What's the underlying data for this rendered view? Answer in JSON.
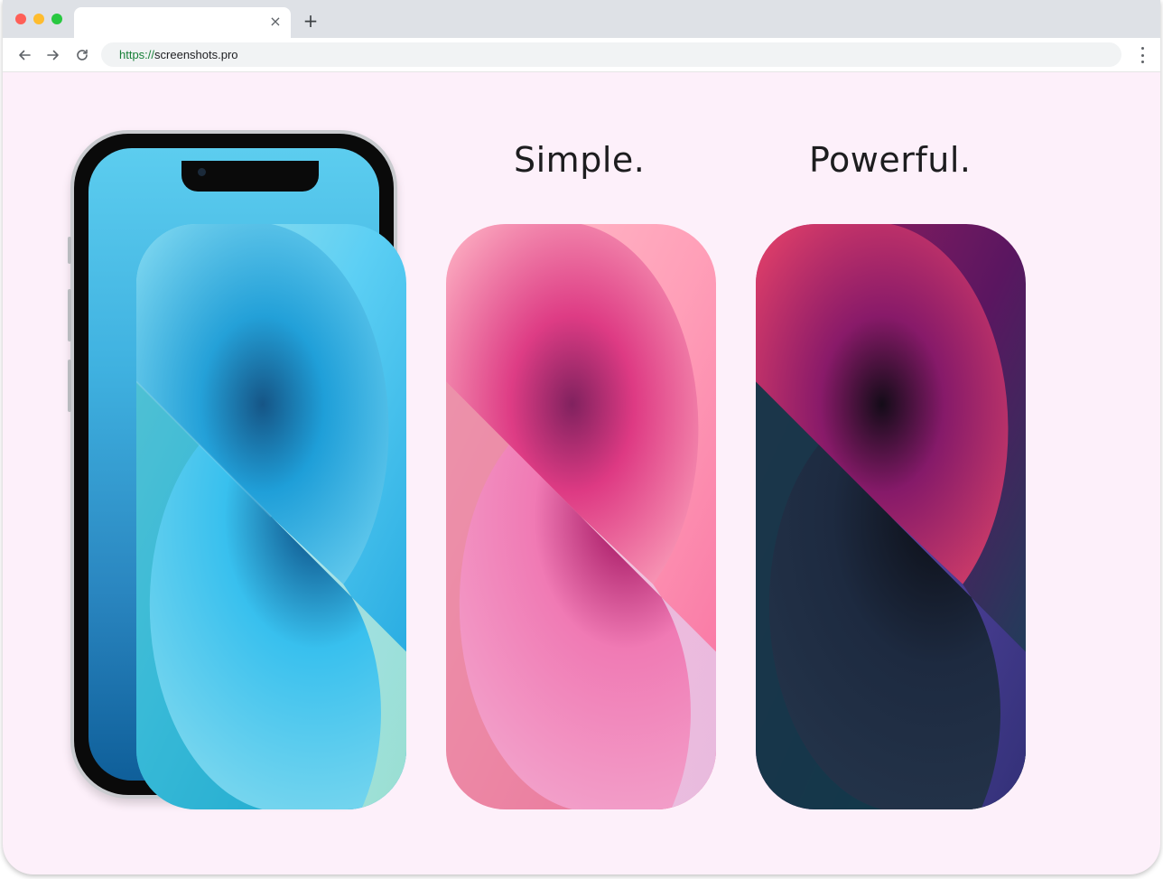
{
  "browser": {
    "url_scheme": "https://",
    "url_host": "screenshots.pro",
    "tab_close": "×",
    "new_tab": "+"
  },
  "icons": {
    "back": "arrow-left-icon",
    "forward": "arrow-right-icon",
    "reload": "reload-icon",
    "menu": "kebab-menu-icon"
  },
  "headings": {
    "first": "Simple.",
    "second": "Powerful."
  },
  "wallpapers": [
    {
      "theme": "blue",
      "colors": [
        "#5ed0f2",
        "#0e8fc9",
        "#0a3e6e",
        "#9fe0d0"
      ]
    },
    {
      "theme": "pink",
      "colors": [
        "#ffb8c8",
        "#e0287a",
        "#6a0a4a",
        "#e4c4e4"
      ]
    },
    {
      "theme": "midnight",
      "colors": [
        "#f0466a",
        "#8a1a6a",
        "#10121a",
        "#3a3a8a"
      ]
    }
  ],
  "colors": {
    "page_background": "#fdf0fa",
    "heading_text": "#1d1d1f"
  }
}
